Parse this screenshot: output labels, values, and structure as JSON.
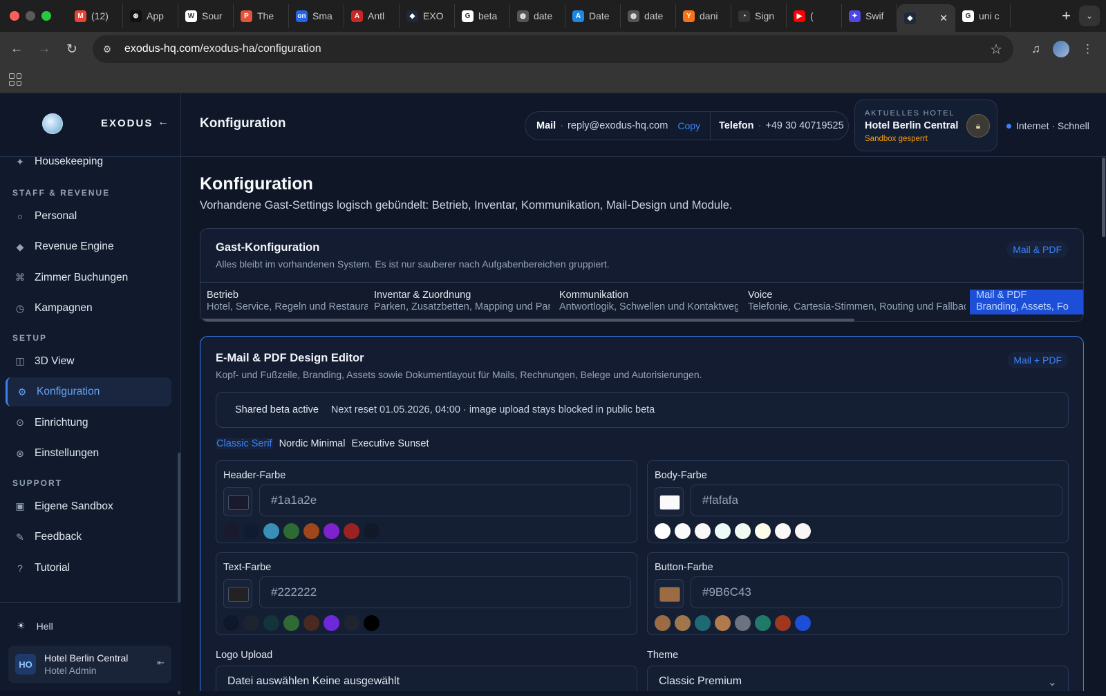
{
  "browser": {
    "tabs": [
      {
        "label": "(12)",
        "icon": "gmail-icon",
        "color": "#ea4335"
      },
      {
        "label": "App",
        "icon": "openai-icon",
        "color": "#111111"
      },
      {
        "label": "Sour",
        "icon": "w-icon",
        "color": "#ffffff"
      },
      {
        "label": "The",
        "icon": "p-icon",
        "color": "#e5533d"
      },
      {
        "label": "Sma",
        "icon": "on-icon",
        "color": "#2563eb"
      },
      {
        "label": "Antl",
        "icon": "antlr-icon",
        "color": "#c62828"
      },
      {
        "label": "EXO",
        "icon": "exodus-icon",
        "color": "#1e293b"
      },
      {
        "label": "beta",
        "icon": "google-icon",
        "color": "#ffffff"
      },
      {
        "label": "date",
        "icon": "globe-icon",
        "color": "#555555"
      },
      {
        "label": "Date",
        "icon": "appstore-icon",
        "color": "#1e88e5"
      },
      {
        "label": "date",
        "icon": "globe-icon",
        "color": "#555555"
      },
      {
        "label": "dani",
        "icon": "y-icon",
        "color": "#f97316"
      },
      {
        "label": "Sign",
        "icon": "clock-icon",
        "color": "#333333"
      },
      {
        "label": "(",
        "icon": "youtube-icon",
        "color": "#ff0000"
      },
      {
        "label": "Swif",
        "icon": "gemini-icon",
        "color": "#4f46e5"
      },
      {
        "label": "",
        "icon": "exodus-icon",
        "color": "#1e293b",
        "active": true
      },
      {
        "label": "uni c",
        "icon": "google-icon",
        "color": "#ffffff"
      }
    ],
    "url_host": "exodus-hq.com",
    "url_path": "/exodus-ha/configuration"
  },
  "sidebar": {
    "brand": "EXODUS",
    "items_top": [
      {
        "label": "Housekeeping",
        "icon": "sparkle-icon"
      }
    ],
    "sections": [
      {
        "title": "STAFF & REVENUE",
        "items": [
          {
            "label": "Personal",
            "icon": "circle-icon"
          },
          {
            "label": "Revenue Engine",
            "icon": "diamond-icon"
          },
          {
            "label": "Zimmer Buchungen",
            "icon": "command-icon"
          },
          {
            "label": "Kampagnen",
            "icon": "timer-icon"
          }
        ]
      },
      {
        "title": "SETUP",
        "items": [
          {
            "label": "3D View",
            "icon": "cube-icon"
          },
          {
            "label": "Konfiguration",
            "icon": "gear-icon",
            "active": true
          },
          {
            "label": "Einrichtung",
            "icon": "target-icon"
          },
          {
            "label": "Einstellungen",
            "icon": "settings-icon"
          }
        ]
      },
      {
        "title": "SUPPORT",
        "items": [
          {
            "label": "Eigene Sandbox",
            "icon": "square-icon"
          },
          {
            "label": "Feedback",
            "icon": "pencil-icon"
          },
          {
            "label": "Tutorial",
            "icon": "question-icon"
          }
        ]
      }
    ],
    "theme_label": "Hell",
    "user": {
      "initials": "HO",
      "name": "Hotel Berlin Central",
      "role": "Hotel Admin"
    }
  },
  "header": {
    "title": "Konfiguration",
    "mail_label": "Mail",
    "mail_value": "reply@exodus-hq.com",
    "copy_label": "Copy",
    "phone_label": "Telefon",
    "phone_value": "+49 30 40719525",
    "hotel_label": "AKTUELLES HOTEL",
    "hotel_name": "Hotel Berlin Central",
    "hotel_status": "Sandbox gesperrt",
    "net_status": "Internet · Schnell"
  },
  "page": {
    "title": "Konfiguration",
    "subtitle": "Vorhandene Gast-Settings logisch gebündelt: Betrieb, Inventar, Kommunikation, Mail-Design und Module."
  },
  "guest_config": {
    "title": "Gast-Konfiguration",
    "subtitle": "Alles bleibt im vorhandenen System. Es ist nur sauberer nach Aufgabenbereichen gruppiert.",
    "badge": "Mail & PDF",
    "tabs": [
      {
        "title": "Betrieb",
        "desc": "Hotel, Service, Regeln und Restaurant."
      },
      {
        "title": "Inventar & Zuordnung",
        "desc": "Parken, Zusatzbetten, Mapping und Parser."
      },
      {
        "title": "Kommunikation",
        "desc": "Antwortlogik, Schwellen und Kontaktwege."
      },
      {
        "title": "Voice",
        "desc": "Telefonie, Cartesia-Stimmen, Routing und Fallbacks."
      },
      {
        "title": "Mail & PDF",
        "desc": "Branding, Assets, Fo",
        "active": true
      }
    ]
  },
  "editor": {
    "title": "E-Mail & PDF Design Editor",
    "subtitle": "Kopf- und Fußzeile, Branding, Assets sowie Dokumentlayout für Mails, Rechnungen, Belege und Autorisierungen.",
    "badge": "Mail + PDF",
    "beta_label": "Shared beta active",
    "beta_text": "Next reset 01.05.2026, 04:00 · image upload stays blocked in public beta",
    "presets": [
      "Classic Serif",
      "Nordic Minimal",
      "Executive Sunset"
    ],
    "active_preset": "Classic Serif",
    "colors": [
      {
        "label": "Header-Farbe",
        "value": "#1a1a2e",
        "swatch": "#1a1a2e",
        "palette": [
          "#1a1a2e",
          "#0f1a33",
          "#3a8fb7",
          "#2e6b34",
          "#a0461c",
          "#7e22ce",
          "#9b2222",
          "#111827"
        ]
      },
      {
        "label": "Body-Farbe",
        "value": "#fafafa",
        "swatch": "#fafafa",
        "palette": [
          "#ffffff",
          "#fafafa",
          "#f8f8f8",
          "#eefaf8",
          "#f3faf1",
          "#fdfbe9",
          "#fbf6f7",
          "#f8f6f4"
        ]
      },
      {
        "label": "Text-Farbe",
        "value": "#222222",
        "swatch": "#222222",
        "palette": [
          "#0f172a",
          "#1e2330",
          "#12343a",
          "#2e6b34",
          "#4a2a1e",
          "#6d28d9",
          "#1f2430",
          "#000000"
        ]
      },
      {
        "label": "Button-Farbe",
        "value": "#9B6C43",
        "swatch": "#9B6C43",
        "palette": [
          "#9B6C43",
          "#a0774a",
          "#1e6a73",
          "#b07a4d",
          "#6b7280",
          "#1f7a6a",
          "#a0361c",
          "#1d4ed8"
        ]
      }
    ],
    "logo_label": "Logo Upload",
    "logo_value": "Datei auswählen Keine ausgewählt",
    "theme_label": "Theme",
    "theme_value": "Classic Premium"
  }
}
